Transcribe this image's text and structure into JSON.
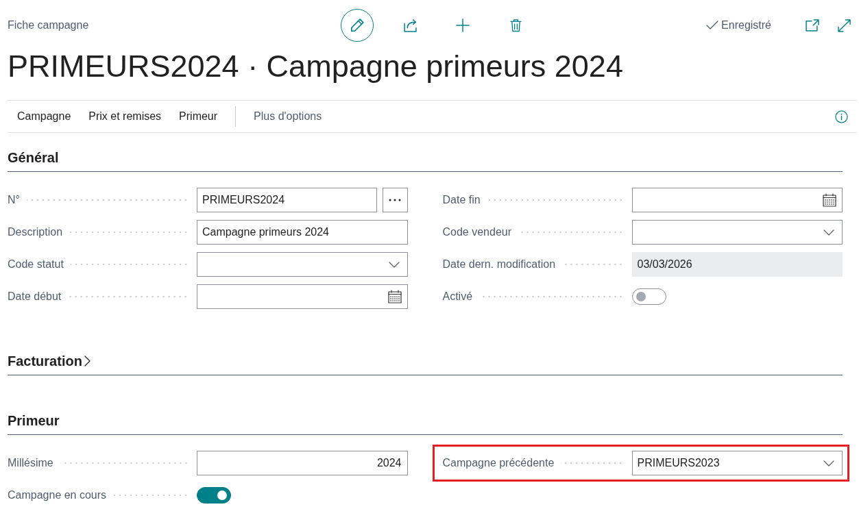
{
  "header": {
    "caption": "Fiche campagne",
    "editing": true,
    "status": "Enregistré",
    "title": "PRIMEURS2024 · Campagne primeurs 2024"
  },
  "action_bar": {
    "items": [
      "Campagne",
      "Prix et remises",
      "Primeur"
    ],
    "more": "Plus d'options"
  },
  "sections": [
    {
      "title": "Général",
      "expanded": true,
      "columns": [
        [
          {
            "kind": "assist",
            "label": "N°",
            "value": "PRIMEURS2024",
            "highlighted": false
          },
          {
            "kind": "text",
            "label": "Description",
            "value": "Campagne primeurs 2024",
            "highlighted": false
          },
          {
            "kind": "dropdown",
            "label": "Code statut",
            "highlighted": false
          },
          {
            "kind": "date",
            "label": "Date début",
            "highlighted": false
          }
        ],
        [
          {
            "kind": "date",
            "label": "Date fin",
            "highlighted": false
          },
          {
            "kind": "dropdown",
            "label": "Code vendeur",
            "highlighted": false
          },
          {
            "kind": "readonly",
            "label": "Date dern. modification",
            "value": "03/03/2026",
            "highlighted": false
          },
          {
            "kind": "toggle",
            "label": "Activé",
            "on": false,
            "highlighted": false
          }
        ]
      ]
    },
    {
      "title": "Facturation",
      "expanded": false
    },
    {
      "title": "Primeur",
      "expanded": true,
      "columns": [
        [
          {
            "kind": "number",
            "label": "Millésime",
            "value": "2024",
            "highlighted": false
          },
          {
            "kind": "toggle",
            "label": "Campagne en cours",
            "on": true,
            "highlighted": false
          }
        ],
        [
          {
            "kind": "dropdown",
            "label": "Campagne précédente",
            "value": "PRIMEURS2023",
            "highlighted": true
          }
        ]
      ]
    }
  ]
}
